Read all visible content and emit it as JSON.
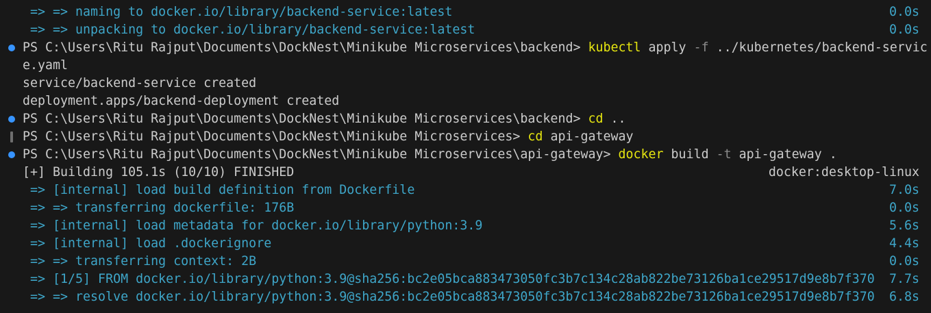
{
  "lines": [
    {
      "type": "step",
      "text": " => => naming to docker.io/library/backend-service:latest",
      "time": "0.0s"
    },
    {
      "type": "step",
      "text": " => => unpacking to docker.io/library/backend-service:latest",
      "time": "0.0s"
    },
    {
      "type": "prompt",
      "prompt": "PS C:\\Users\\Ritu Rajput\\Documents\\DockNest\\Minikube Microservices\\backend> ",
      "command": "kubectl",
      "args": [
        {
          "text": " apply ",
          "style": "white"
        },
        {
          "text": "-f",
          "style": "gray"
        },
        {
          "text": " ../kubernetes/backend-servic",
          "style": "white"
        }
      ]
    },
    {
      "type": "output",
      "text": "e.yaml"
    },
    {
      "type": "output",
      "text": "service/backend-service created"
    },
    {
      "type": "output",
      "text": "deployment.apps/backend-deployment created"
    },
    {
      "type": "prompt",
      "prompt": "PS C:\\Users\\Ritu Rajput\\Documents\\DockNest\\Minikube Microservices\\backend> ",
      "command": "cd",
      "args": [
        {
          "text": " ..",
          "style": "white"
        }
      ]
    },
    {
      "type": "prompt-bar",
      "prompt": "PS C:\\Users\\Ritu Rajput\\Documents\\DockNest\\Minikube Microservices> ",
      "command": "cd",
      "args": [
        {
          "text": " api-gateway",
          "style": "white"
        }
      ]
    },
    {
      "type": "prompt",
      "prompt": "PS C:\\Users\\Ritu Rajput\\Documents\\DockNest\\Minikube Microservices\\api-gateway> ",
      "command": "docker",
      "args": [
        {
          "text": " build ",
          "style": "white"
        },
        {
          "text": "-t",
          "style": "gray"
        },
        {
          "text": " api-gateway .",
          "style": "white"
        }
      ]
    },
    {
      "type": "header",
      "text": "[+] Building 105.1s (10/10) FINISHED",
      "right": "docker:desktop-linux"
    },
    {
      "type": "step",
      "text": " => [internal] load build definition from Dockerfile",
      "time": "7.0s"
    },
    {
      "type": "step",
      "text": " => => transferring dockerfile: 176B",
      "time": "0.0s"
    },
    {
      "type": "step",
      "text": " => [internal] load metadata for docker.io/library/python:3.9",
      "time": "5.6s"
    },
    {
      "type": "step",
      "text": " => [internal] load .dockerignore",
      "time": "4.4s"
    },
    {
      "type": "step",
      "text": " => => transferring context: 2B",
      "time": "0.0s"
    },
    {
      "type": "step",
      "text": " => [1/5] FROM docker.io/library/python:3.9@sha256:bc2e05bca883473050fc3b7c134c28ab822be73126ba1ce29517d9e8b7f370",
      "time": "7.7s"
    },
    {
      "type": "step",
      "text": " => => resolve docker.io/library/python:3.9@sha256:bc2e05bca883473050fc3b7c134c28ab822be73126ba1ce29517d9e8b7f370",
      "time": "6.8s"
    }
  ],
  "colors": {
    "background": "#181818",
    "foreground": "#cccccc",
    "step": "#3ea6c9",
    "command": "#e5e510",
    "flag": "#8b8b8b",
    "prompt_dot": "#3794ff"
  }
}
